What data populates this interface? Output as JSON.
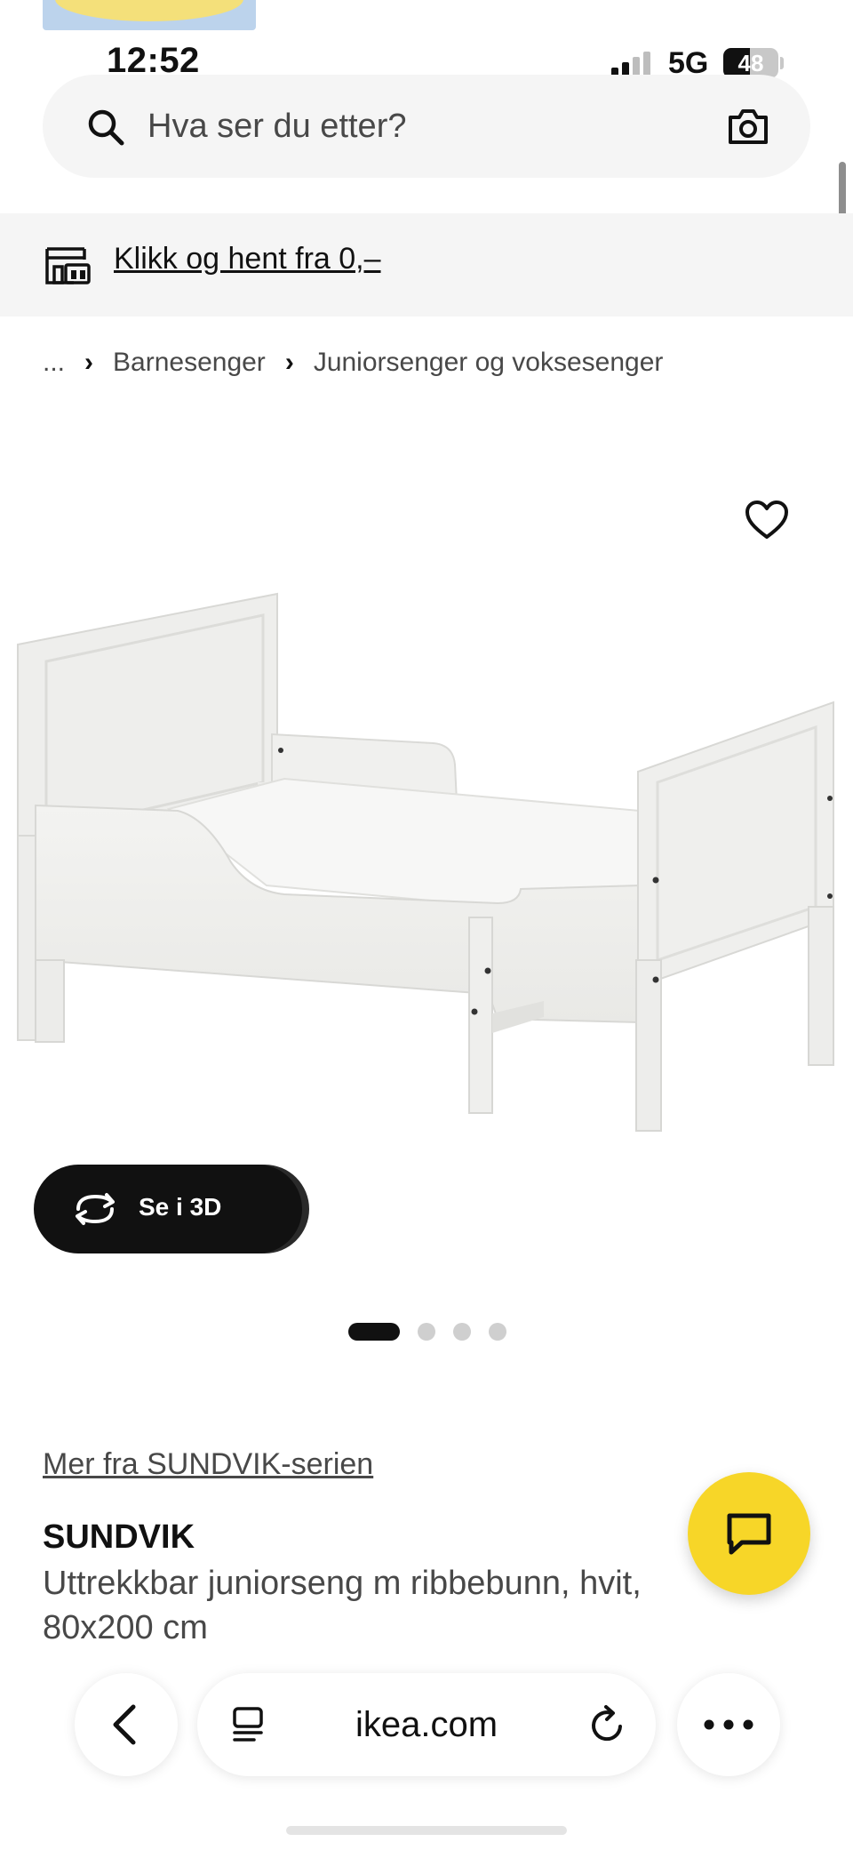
{
  "status_bar": {
    "time": "12:52",
    "network": "5G",
    "battery_percent": "48",
    "battery_level": 0.48,
    "signal_bars_active": 2,
    "signal_bars_total": 4
  },
  "search": {
    "placeholder": "Hva ser du etter?"
  },
  "banner": {
    "label": "Klikk og hent fra 0,–"
  },
  "breadcrumb": {
    "ellipsis": "...",
    "items": [
      "Barnesenger",
      "Juniorsenger og voksesenger"
    ]
  },
  "gallery": {
    "button_3d_label": "Se i 3D",
    "slide_count": 4,
    "active_slide": 1
  },
  "product": {
    "series_link": "Mer fra SUNDVIK-serien",
    "name": "SUNDVIK",
    "description": "Uttrekkbar juniorseng m ribbebunn, hvit, 80x200 cm"
  },
  "browser": {
    "domain": "ikea.com"
  },
  "icons": {
    "search": "search-icon",
    "camera": "camera-icon",
    "store": "store-icon",
    "wishlist": "heart-icon",
    "rotate_3d": "rotate-3d-icon",
    "chat": "chat-icon",
    "back": "chevron-left-icon",
    "reader": "reader-icon",
    "reload": "reload-icon",
    "more": "more-icon"
  },
  "colors": {
    "accent_yellow": "#F7D628",
    "surface_grey": "#F5F5F5",
    "text_primary": "#111111",
    "text_secondary": "#484848"
  }
}
